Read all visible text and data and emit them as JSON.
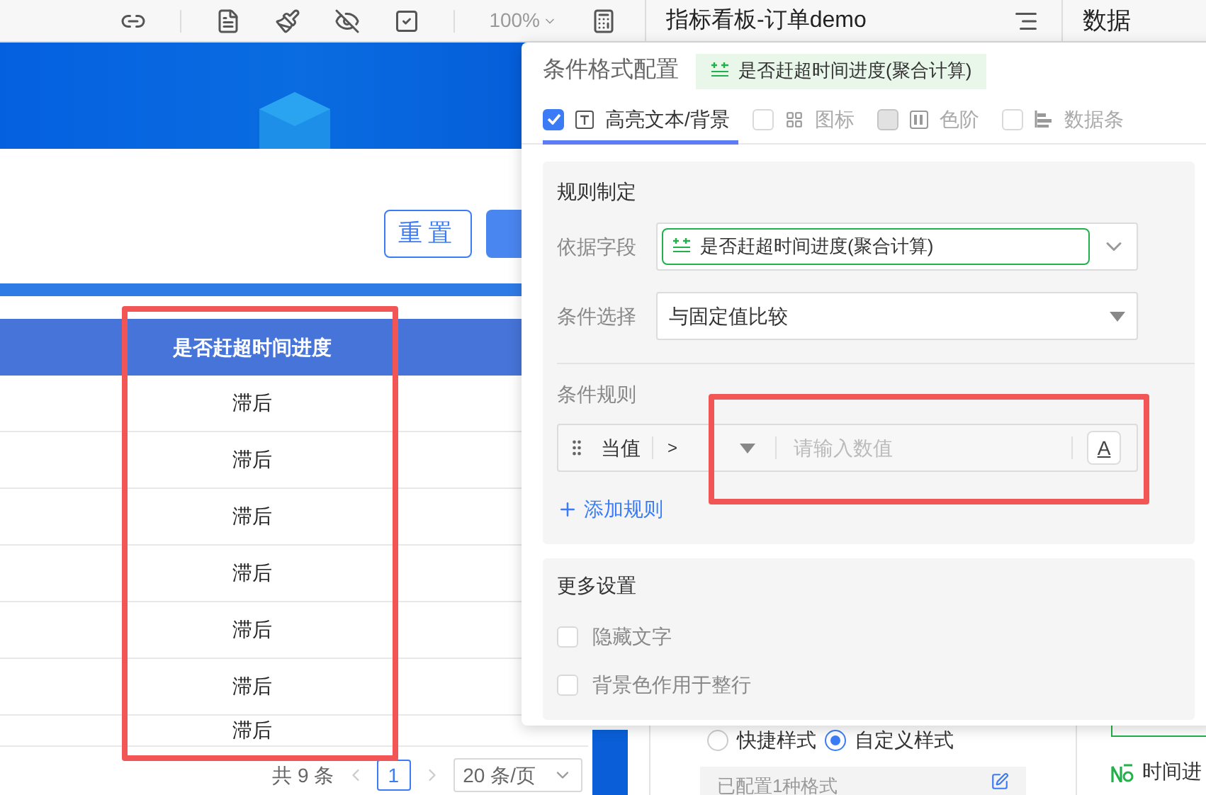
{
  "toolbar": {
    "zoom": "100%",
    "report_title": "指标看板-订单demo",
    "panel_tab": "数据"
  },
  "filter": {
    "buttons": [
      {
        "label": "重置",
        "kind": "outline"
      },
      {
        "kind": "primary"
      }
    ]
  },
  "table": {
    "columns": [
      "是否赶超时间进度"
    ],
    "rows": [
      "滞后",
      "滞后",
      "滞后",
      "滞后",
      "滞后",
      "滞后",
      "滞后"
    ]
  },
  "pagination": {
    "total": "共 9 条",
    "page": "1",
    "page_size": "20 条/页"
  },
  "style_panel": {
    "radios": [
      {
        "label": "快捷样式",
        "selected": false
      },
      {
        "label": "自定义样式",
        "selected": true
      }
    ],
    "configured": "已配置1种格式"
  },
  "right_panel": {
    "field": "时间进"
  },
  "popup": {
    "title": "条件格式配置",
    "field_tag": "是否赶超时间进度(聚合计算)",
    "tabs": [
      {
        "label": "高亮文本/背景",
        "checked": true,
        "disabled": false,
        "selected": true
      },
      {
        "label": "图标",
        "checked": false,
        "disabled": false,
        "selected": false
      },
      {
        "label": "色阶",
        "checked": false,
        "disabled": true,
        "selected": false
      },
      {
        "label": "数据条",
        "checked": false,
        "disabled": false,
        "selected": false
      }
    ],
    "rules": {
      "title": "规则制定",
      "field_label": "依据字段",
      "field_value": "是否赶超时间进度(聚合计算)",
      "condition_label": "条件选择",
      "condition_value": "与固定值比较",
      "rule_label": "条件规则",
      "rule": {
        "subject": "当值",
        "operator": ">",
        "placeholder": "请输入数值",
        "font_button": "A"
      },
      "add_rule": "添加规则"
    },
    "more": {
      "title": "更多设置",
      "options": [
        {
          "label": "隐藏文字",
          "checked": false
        },
        {
          "label": "背景色作用于整行",
          "checked": false
        }
      ]
    }
  }
}
